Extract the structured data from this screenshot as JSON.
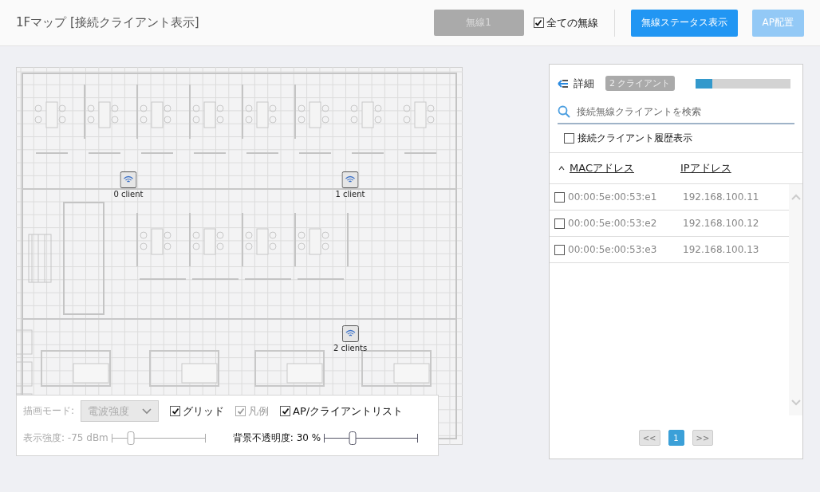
{
  "header": {
    "title": "1Fマップ [接続クライアント表示]",
    "radio_button": {
      "label": "無線1",
      "disabled": true
    },
    "all_radios": {
      "label": "全ての無線",
      "checked": true
    },
    "buttons": [
      {
        "label": "無線ステータス表示",
        "disabled": false
      },
      {
        "label": "AP配置",
        "disabled": true
      }
    ]
  },
  "map": {
    "access_points": [
      {
        "label": "0 client"
      },
      {
        "label": "1 client"
      },
      {
        "label": "2 clients"
      }
    ],
    "controls": {
      "mode_label": "描画モード:",
      "mode_select": {
        "value": "電波強度",
        "disabled": true
      },
      "checkboxes": [
        {
          "label": "グリッド",
          "checked": true,
          "disabled": false
        },
        {
          "label": "凡例",
          "checked": true,
          "disabled": true
        },
        {
          "label": "AP/クライアントリスト",
          "checked": true,
          "disabled": false
        }
      ],
      "sliders": [
        {
          "label": "表示強度: -75 dBm",
          "level": 0.2,
          "disabled": true
        },
        {
          "label": "背景不透明度: 30 %",
          "level": 0.3,
          "disabled": false
        }
      ]
    }
  },
  "panel": {
    "title": "詳細",
    "badge": "2 クライアント",
    "progress": {
      "level": 0.18
    },
    "search": {
      "placeholder": "接続無線クライアントを検索"
    },
    "history": {
      "label": "接続クライアント履歴表示",
      "checked": false
    },
    "columns": [
      {
        "label": "MACアドレス",
        "sorted": true
      },
      {
        "label": "IPアドレス",
        "sorted": false
      }
    ],
    "rows": [
      {
        "mac": "00:00:5e:00:53:e1",
        "ip": "192.168.100.11",
        "checked": false
      },
      {
        "mac": "00:00:5e:00:53:e2",
        "ip": "192.168.100.12",
        "checked": false
      },
      {
        "mac": "00:00:5e:00:53:e3",
        "ip": "192.168.100.13",
        "checked": false
      }
    ],
    "pagination": [
      {
        "label": "<<",
        "selected": false
      },
      {
        "label": "1",
        "selected": true
      },
      {
        "label": ">>",
        "selected": false
      }
    ]
  }
}
